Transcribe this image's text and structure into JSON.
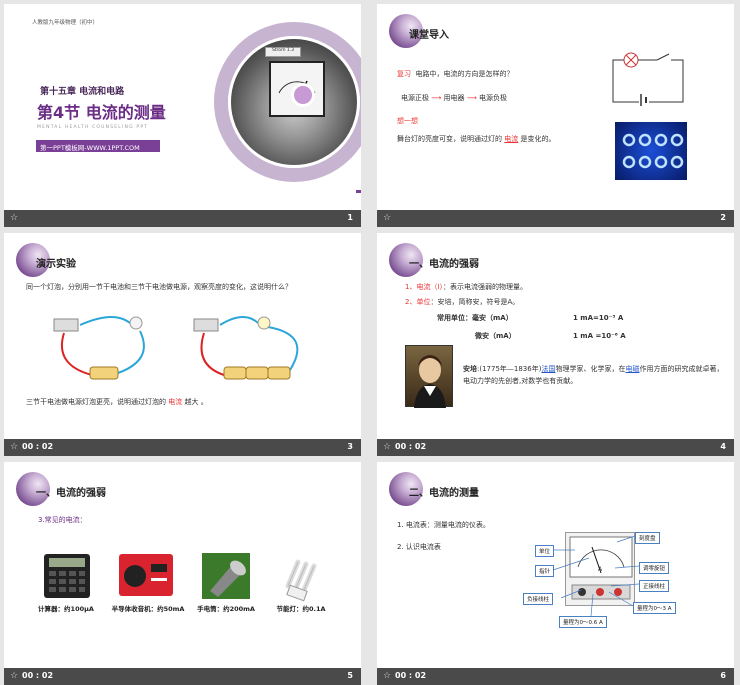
{
  "slides": [
    {
      "number": "1",
      "footer_star": "☆",
      "top_text": "人教版九年级物理（初中）",
      "chapter": "第十五章   电流和电路",
      "title": "第4节  电流的测量",
      "subtitle": "MENTAL HEALTH COUNSELING PPT",
      "badge": "第一PPT模板网-WWW.1PPT.COM",
      "meter_label": "Strom 1.3"
    },
    {
      "number": "2",
      "footer_star": "☆",
      "heading": "课堂导入",
      "review_label": "复习",
      "review_text": "电路中，电流的方向是怎样的？",
      "flow": [
        "电源正极",
        "用电器",
        "电源负极"
      ],
      "think_label": "想一想",
      "stage_text_1": "舞台灯的亮度可变，说明通过灯的",
      "stage_blank": "电流",
      "stage_text_2": "是变化的。"
    },
    {
      "number": "3",
      "footer_star": "☆",
      "time": "00 : 02",
      "heading": "演示实验",
      "intro": "同一个灯泡，分别用一节干电池和三节干电池做电源，观察亮度的变化，这说明什么？",
      "conclusion_1": "三节干电池做电源灯泡更亮，说明通过灯泡的",
      "conclusion_blank": "电流",
      "conclusion_2": "越大  。"
    },
    {
      "number": "4",
      "footer_star": "☆",
      "time": "00 : 02",
      "heading": "一、电流的强弱",
      "item1_label": "1、电流（I）",
      "item1_text": "：表示电流强弱的物理量。",
      "item2_label": "2、单位",
      "item2_text": "：安培，简称安，符号是A。",
      "common_units": "常用单位：",
      "unit_ma": "毫安（mA）",
      "unit_ma_eq": "1 mA=10⁻³ A",
      "unit_ua": "微安（mA）",
      "unit_ua_eq": "1 mA =10⁻⁶ A",
      "bio_name": "安培",
      "bio_1": ":(1775年—1836年)",
      "bio_country": "法国",
      "bio_2": "物理学家、化学家，在",
      "bio_field": "电磁",
      "bio_3": "作用方面的研究成就卓著，电动力学的先创者,对数学也有贡献。"
    },
    {
      "number": "5",
      "footer_star": "☆",
      "time": "00 : 02",
      "heading": "一、电流的强弱",
      "common_currents": "3.常见的电流：",
      "items": [
        {
          "label": "计算器：约100μA"
        },
        {
          "label": "半导体收音机：约50mA"
        },
        {
          "label": "手电筒：约200mA"
        },
        {
          "label": "节能灯：约0.1A"
        }
      ]
    },
    {
      "number": "6",
      "footer_star": "☆",
      "time": "00 : 02",
      "heading": "二、电流的测量",
      "item1": "1. 电流表：测量电流的仪表。",
      "item2": "2. 认识电流表",
      "callouts": {
        "unit": "单位",
        "dial": "刻度盘",
        "pointer": "指针",
        "zero_knob": "调零旋钮",
        "positive": "正接线柱",
        "negative": "负接线柱",
        "range_big": "量程为0～3 A",
        "range_small": "量程为0～0.6 A"
      }
    }
  ],
  "colors": {
    "accent_purple": "#6b2d86",
    "footer_bg": "#4a4a4a",
    "red_text": "#e33333",
    "blue_text": "#2255cc"
  }
}
